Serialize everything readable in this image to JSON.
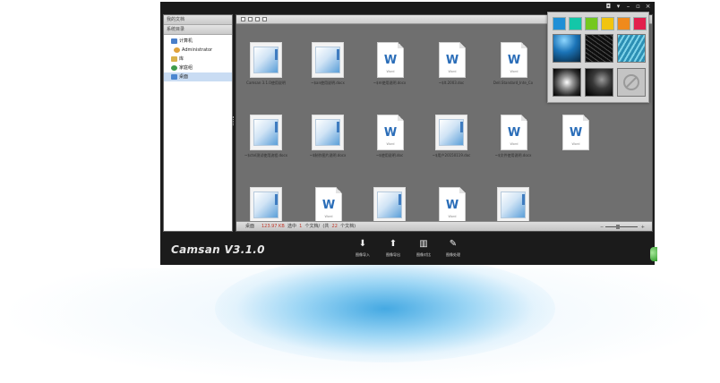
{
  "app": {
    "brand": "Camsan V3.1.0"
  },
  "window_controls": [
    "◘",
    "▾",
    "–",
    "▫",
    "×"
  ],
  "sidebar": {
    "header": "我的文档",
    "section": "系统目录",
    "items": [
      {
        "label": "计算机",
        "icon": "computer-icon",
        "color": "#4a7fc9"
      },
      {
        "label": "Administrator",
        "icon": "user-icon",
        "color": "#e0a23a"
      },
      {
        "label": "库",
        "icon": "library-icon",
        "color": "#d9b24a"
      },
      {
        "label": "家庭组",
        "icon": "homegroup-icon",
        "color": "#3e9b4a"
      },
      {
        "label": "桌面",
        "icon": "desktop-icon",
        "color": "#4b86d0"
      }
    ]
  },
  "files": [
    {
      "type": "app",
      "caption": "Camsan 3.1.0使用说明"
    },
    {
      "type": "app",
      "caption": "~$an使用说明.docx"
    },
    {
      "type": "word",
      "caption": "~$m使用说明.docx"
    },
    {
      "type": "word",
      "caption": "~$lt.2003.doc"
    },
    {
      "type": "word",
      "caption": "Dell.Standard_Inte_Co"
    },
    {
      "type": "app",
      "caption": "~$01项目表.docx"
    },
    {
      "type": "app",
      "caption": "~$ctel测试使用流程.docx"
    },
    {
      "type": "app",
      "caption": "~$制作图片说明.docx"
    },
    {
      "type": "word",
      "caption": "~$使用说明.doc"
    },
    {
      "type": "app",
      "caption": "~$用户20150119.doc"
    },
    {
      "type": "word",
      "caption": "~$文件使用说明.docx"
    },
    {
      "type": "word",
      "caption": ""
    },
    {
      "type": "app",
      "caption": ""
    },
    {
      "type": "word",
      "caption": ""
    },
    {
      "type": "app",
      "caption": ""
    },
    {
      "type": "word",
      "caption": ""
    },
    {
      "type": "app",
      "caption": ""
    }
  ],
  "status": {
    "label": "桌面",
    "size": "123.97 KB",
    "selected_prefix": "选中",
    "selected_count": "1",
    "unit": "个文档/",
    "total_prefix": "(共",
    "total_count": "22",
    "total_suffix": "个文档)",
    "zoom_minus": "−",
    "zoom_plus": "+"
  },
  "actions": [
    {
      "label": "图像导入",
      "icon": "import-icon",
      "glyph": "⬇"
    },
    {
      "label": "图像导出",
      "icon": "export-icon",
      "glyph": "⬆"
    },
    {
      "label": "图像对比",
      "icon": "compare-icon",
      "glyph": "▥"
    },
    {
      "label": "图像处理",
      "icon": "edit-icon",
      "glyph": "✎"
    }
  ],
  "theme_swatches": [
    "#1f8fd6",
    "#13c7a8",
    "#74c81f",
    "#f1c40f",
    "#f08a1c",
    "#e21f4c"
  ]
}
